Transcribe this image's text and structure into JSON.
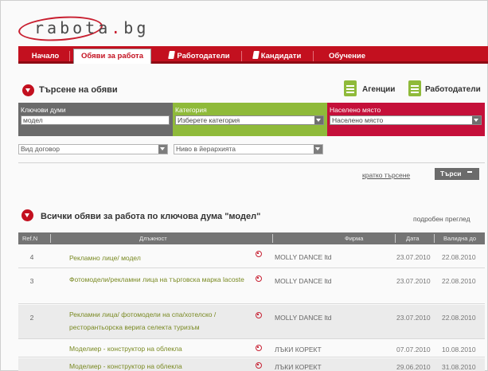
{
  "logo": {
    "text_before": "rabota",
    "dot": ".",
    "text_after": "bg"
  },
  "nav": {
    "tabs": [
      {
        "label": "Начало"
      },
      {
        "label": "Обяви за работа"
      },
      {
        "label": "Работодатели"
      },
      {
        "label": "Кандидати"
      },
      {
        "label": "Обучение"
      }
    ]
  },
  "search": {
    "title": "Търсене на обяви",
    "agencies_label": "Агенции",
    "employers_label": "Работодатели",
    "keywords": {
      "label": "Ключови думи",
      "value": "модел"
    },
    "category": {
      "label": "Категория",
      "value": "Изберете категория"
    },
    "location": {
      "label": "Населено място",
      "value": "Населено място"
    },
    "contract_type": "Вид договор",
    "hierarchy_level": "Ниво в йерархията",
    "quick_search_link": "кратко търсене",
    "search_button": "Търси"
  },
  "results": {
    "title": "Всички обяви за работа по ключова дума \"модел\"",
    "detail_view_link": "подробен преглед",
    "columns": [
      "Ref.N",
      "Длъжност",
      "Фирма",
      "Дата",
      "Валидна до"
    ],
    "rows": [
      {
        "ref": "4",
        "position": "Рекламно лице/ модел",
        "company": "MOLLY DANCE ltd",
        "date": "23.07.2010",
        "valid_until": "22.08.2010"
      },
      {
        "ref": "3",
        "position": "Фотомодели/рекламни лица на търговска марка lacoste",
        "company": "MOLLY DANCE ltd",
        "date": "23.07.2010",
        "valid_until": "22.08.2010"
      },
      {
        "ref": "2",
        "position": "Рекламни лица/ фотомодели на спа/хотелско /ресторантьорска верига селекта туризъм",
        "company": "MOLLY DANCE ltd",
        "date": "23.07.2010",
        "valid_until": "22.08.2010"
      },
      {
        "ref": "",
        "position": "Моделиер - конструктор на облекла",
        "company": "ЛЪКИ КОРЕКТ",
        "date": "07.07.2010",
        "valid_until": "10.08.2010"
      },
      {
        "ref": "",
        "position": "Моделиер - конструктор на облекла",
        "company": "ЛЪКИ КОРЕКТ",
        "date": "29.06.2010",
        "valid_until": "31.08.2010"
      }
    ]
  }
}
